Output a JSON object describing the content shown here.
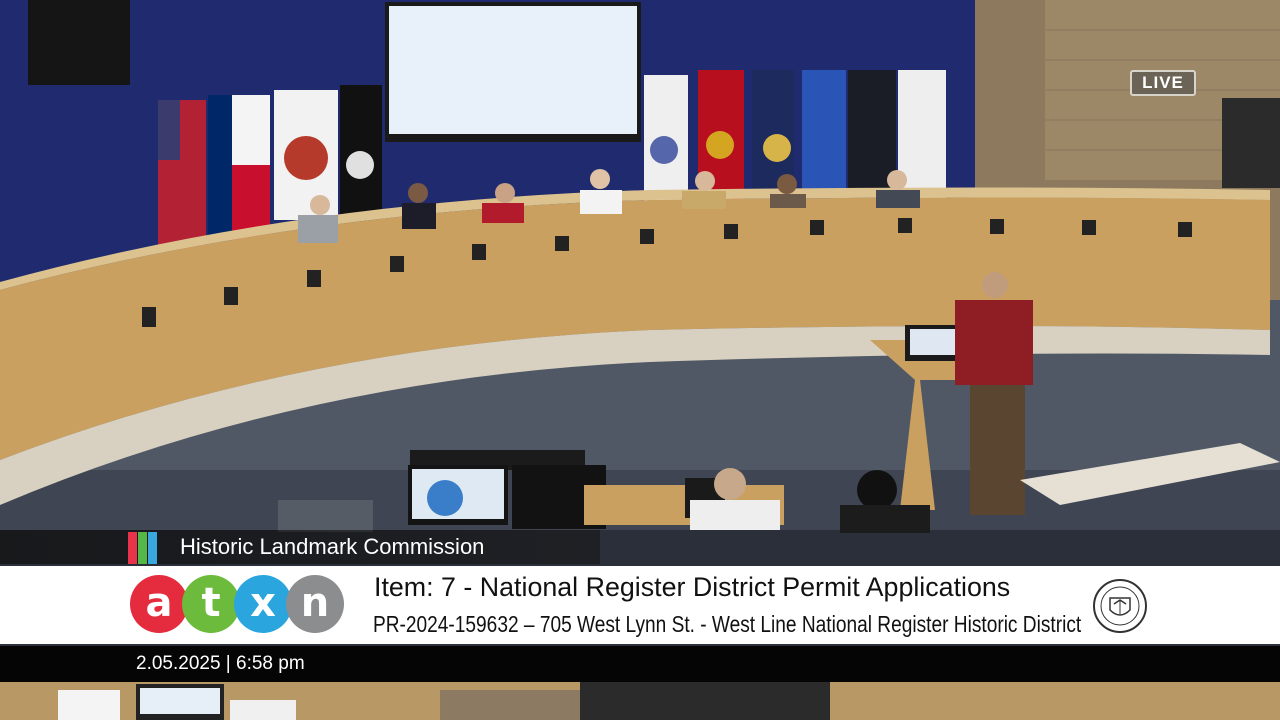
{
  "broadcast": {
    "live_badge": "LIVE",
    "commission_name": "Historic Landmark Commission",
    "stripe_colors": [
      "#e8334a",
      "#53b848",
      "#3aa7dd"
    ]
  },
  "logo": {
    "letters": [
      "a",
      "t",
      "x",
      "n"
    ],
    "colors": [
      "#e42c3e",
      "#6cbb3c",
      "#2aa5de",
      "#8b8d8f"
    ]
  },
  "agenda": {
    "item_line": "Item: 7 - National Register District Permit Applications",
    "case_line": "PR-2024-159632 – 705 West Lynn St. - West Line National Register Historic District"
  },
  "timestamp": "2.05.2025 | 6:58 pm"
}
